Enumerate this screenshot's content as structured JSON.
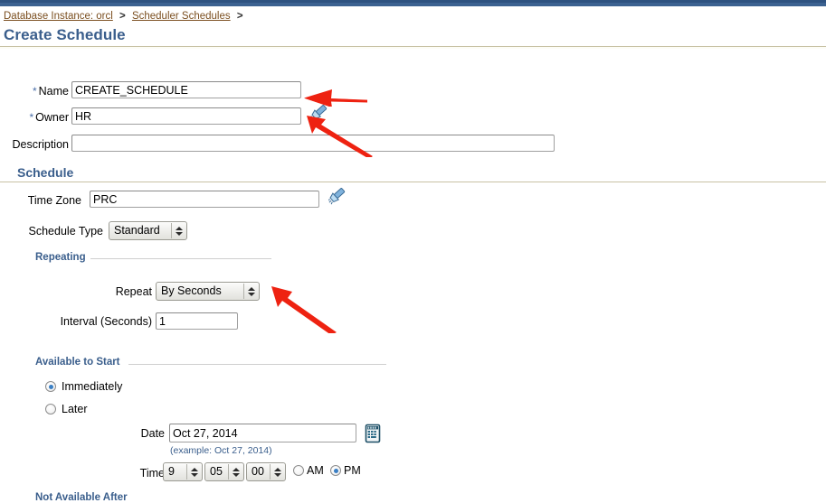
{
  "window": {
    "title": "Create Schedule"
  },
  "breadcrumb": {
    "items": [
      {
        "label": "Database Instance: orcl",
        "link": true
      },
      {
        "label": "Scheduler Schedules",
        "link": true
      }
    ],
    "separator": ">",
    "trailing_separator": ">"
  },
  "page": {
    "title": "Create Schedule"
  },
  "form": {
    "required_marker": "*",
    "name": {
      "label": "Name",
      "value": "CREATE_SCHEDULE",
      "required": true
    },
    "owner": {
      "label": "Owner",
      "value": "HR",
      "required": true,
      "lov_icon": "flashlight-icon"
    },
    "description": {
      "label": "Description",
      "value": "",
      "placeholder": ""
    }
  },
  "schedule_section": {
    "heading": "Schedule",
    "time_zone": {
      "label": "Time Zone",
      "value": "PRC",
      "lov_icon": "flashlight-icon"
    },
    "schedule_type": {
      "label": "Schedule Type",
      "selected": "Standard",
      "options": [
        "Standard"
      ]
    }
  },
  "repeating_section": {
    "heading": "Repeating",
    "repeat": {
      "label": "Repeat",
      "selected": "By Seconds",
      "options": [
        "By Seconds"
      ]
    },
    "interval": {
      "label": "Interval (Seconds)",
      "value": "1"
    }
  },
  "available_to_start": {
    "heading": "Available to Start",
    "options": [
      {
        "label": "Immediately",
        "selected": true
      },
      {
        "label": "Later",
        "selected": false
      }
    ],
    "date": {
      "label": "Date",
      "value": "Oct 27, 2014",
      "example": "(example: Oct 27, 2014)",
      "picker_icon": "calendar-icon"
    },
    "time": {
      "label": "Time",
      "hour": "9",
      "minute": "05",
      "second": "00",
      "meridiem_options": [
        {
          "label": "AM",
          "selected": false
        },
        {
          "label": "PM",
          "selected": true
        }
      ]
    }
  },
  "not_available_after": {
    "heading": "Not Available After"
  },
  "annotations": {
    "arrows": [
      {
        "name": "arrow-to-name-field",
        "direction": "left"
      },
      {
        "name": "arrow-to-owner-lov-icon",
        "direction": "up-left"
      },
      {
        "name": "arrow-to-repeat-select",
        "direction": "up-left"
      }
    ],
    "color": "#ee2211"
  },
  "colors": {
    "topbar": "#3c6291",
    "heading_blue": "#3a5e8c",
    "link_brown": "#7b4f20",
    "rule": "#c8c2a4",
    "arrow_red": "#ee2211",
    "radio_dot": "#3b7fc4"
  }
}
